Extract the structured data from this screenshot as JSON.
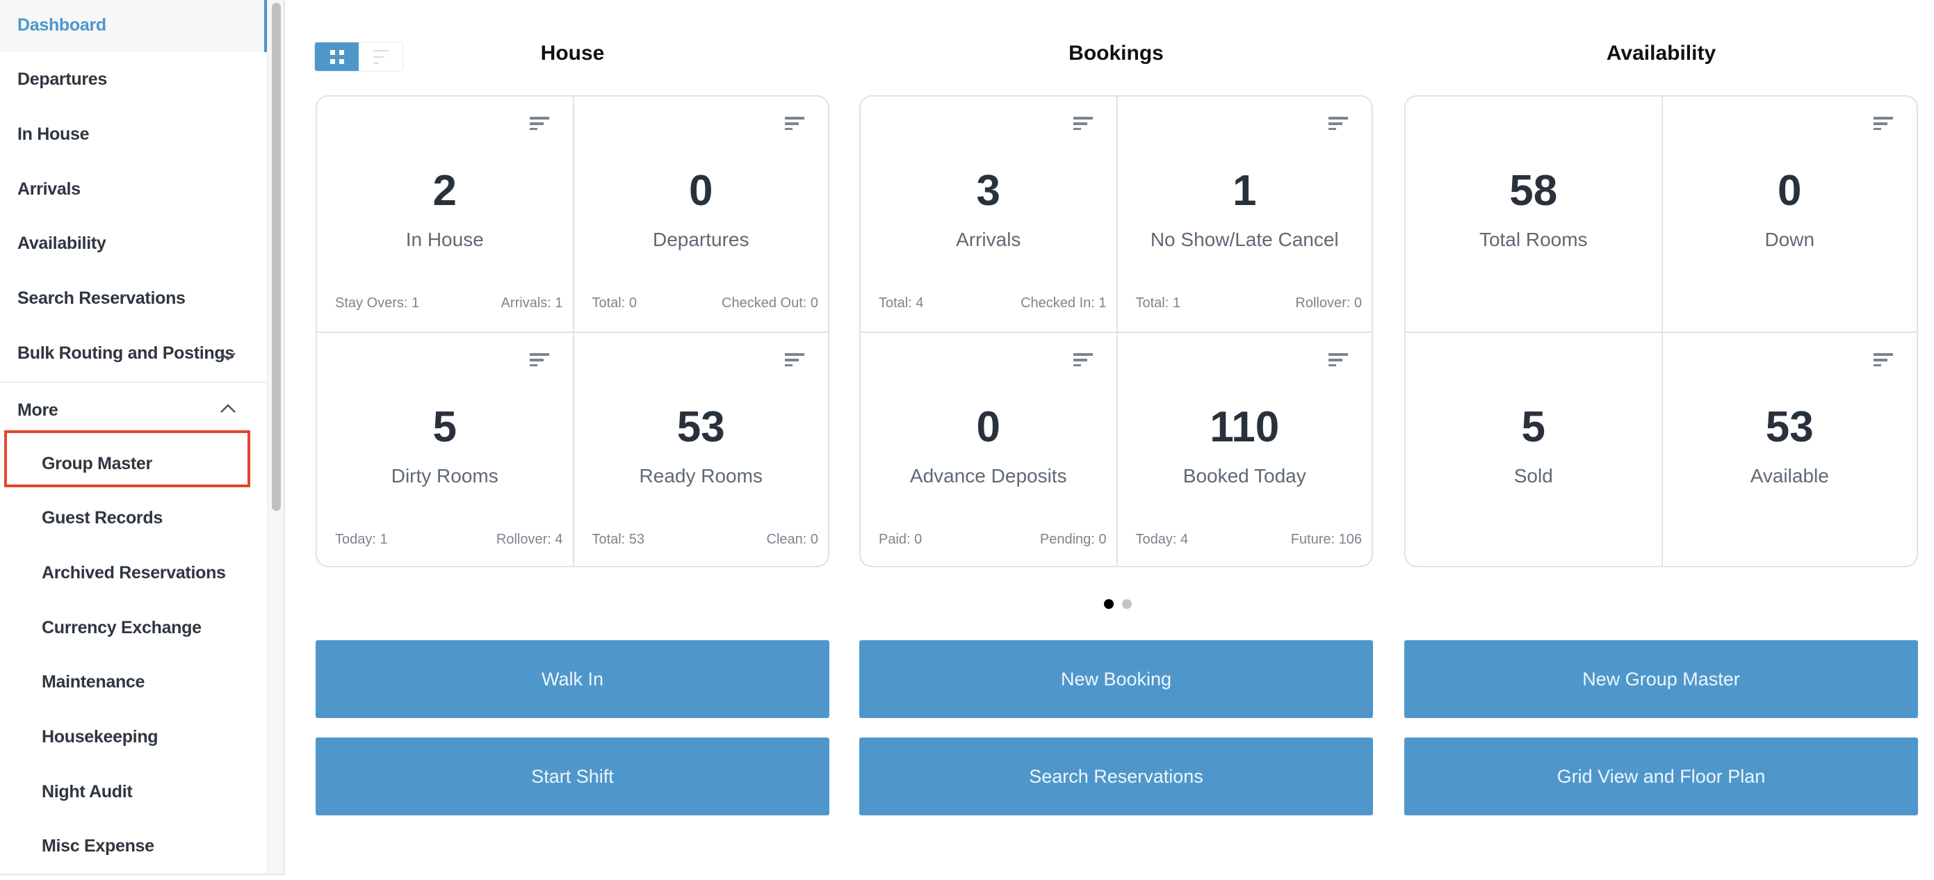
{
  "sidebar": {
    "items": [
      {
        "label": "Dashboard",
        "active": true
      },
      {
        "label": "Departures"
      },
      {
        "label": "In House"
      },
      {
        "label": "Arrivals"
      },
      {
        "label": "Availability"
      },
      {
        "label": "Search Reservations"
      },
      {
        "label": "Bulk Routing and Postings",
        "icon": "chevron-down-icon"
      }
    ],
    "more_label": "More",
    "more_items": [
      {
        "label": "Group Master",
        "highlighted": true
      },
      {
        "label": "Guest Records"
      },
      {
        "label": "Archived Reservations"
      },
      {
        "label": "Currency Exchange"
      },
      {
        "label": "Maintenance"
      },
      {
        "label": "Housekeeping"
      },
      {
        "label": "Night Audit"
      },
      {
        "label": "Misc Expense"
      }
    ]
  },
  "view_toggle": {
    "active": "grid",
    "options": [
      "grid-icon",
      "list-icon"
    ]
  },
  "sections": [
    {
      "title": "House",
      "tiles": [
        {
          "value": "2",
          "label": "In House",
          "foot_left": "Stay Overs: 1",
          "foot_right": "Arrivals: 1"
        },
        {
          "value": "0",
          "label": "Departures",
          "foot_left": "Total: 0",
          "foot_right": "Checked Out: 0"
        },
        {
          "value": "5",
          "label": "Dirty Rooms",
          "foot_left": "Today: 1",
          "foot_right": "Rollover: 4"
        },
        {
          "value": "53",
          "label": "Ready Rooms",
          "foot_left": "Total: 53",
          "foot_right": "Clean: 0"
        }
      ]
    },
    {
      "title": "Bookings",
      "tiles": [
        {
          "value": "3",
          "label": "Arrivals",
          "foot_left": "Total: 4",
          "foot_right": "Checked In: 1"
        },
        {
          "value": "1",
          "label": "No Show/Late Cancel",
          "foot_left": "Total: 1",
          "foot_right": "Rollover: 0"
        },
        {
          "value": "0",
          "label": "Advance Deposits",
          "foot_left": "Paid: 0",
          "foot_right": "Pending: 0"
        },
        {
          "value": "110",
          "label": "Booked Today",
          "foot_left": "Today: 4",
          "foot_right": "Future: 106"
        }
      ]
    },
    {
      "title": "Availability",
      "tiles": [
        {
          "value": "58",
          "label": "Total Rooms"
        },
        {
          "value": "0",
          "label": "Down"
        },
        {
          "value": "5",
          "label": "Sold"
        },
        {
          "value": "53",
          "label": "Available"
        }
      ]
    }
  ],
  "pager": {
    "current": 1,
    "total": 2
  },
  "actions": [
    "Walk In",
    "New Booking",
    "New Group Master",
    "Start Shift",
    "Search Reservations",
    "Grid View and Floor Plan"
  ],
  "colors": {
    "accent": "#4f97ca",
    "highlight": "#e0462d",
    "text": "#2e3640"
  }
}
